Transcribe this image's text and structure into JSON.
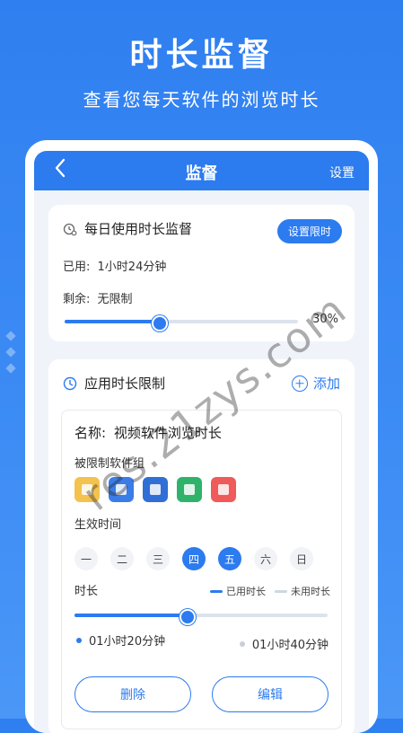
{
  "promo": {
    "title": "时长监督",
    "subtitle": "查看您每天软件的浏览时长"
  },
  "header": {
    "back_icon": "chevron-left-icon",
    "title": "监督",
    "action": "设置"
  },
  "daily": {
    "title": "每日使用时长监督",
    "set_limit": "设置限时",
    "used_label": "已用:",
    "used_value": "1小时24分钟",
    "remain_label": "剩余:",
    "remain_value": "无限制",
    "percent_text": "30%",
    "progress": 0.4
  },
  "limits": {
    "title": "应用时长限制",
    "add": "添加",
    "rule": {
      "name_label": "名称:",
      "name_value": "视频软件浏览时长",
      "group_label": "被限制软件组",
      "apps": [
        {
          "icon": "app-kids-icon",
          "color": "#f3c24f"
        },
        {
          "icon": "app-video-icon",
          "color": "#3a7de8"
        },
        {
          "icon": "app-pdf-icon",
          "color": "#2f6fd6"
        },
        {
          "icon": "app-lock-icon",
          "color": "#2fb36b"
        },
        {
          "icon": "app-share-icon",
          "color": "#ef5a5a"
        }
      ],
      "effective_label": "生效时间",
      "days": [
        {
          "label": "一",
          "on": false
        },
        {
          "label": "二",
          "on": false
        },
        {
          "label": "三",
          "on": false
        },
        {
          "label": "四",
          "on": true
        },
        {
          "label": "五",
          "on": true
        },
        {
          "label": "六",
          "on": false
        },
        {
          "label": "日",
          "on": false
        }
      ],
      "duration_label": "时长",
      "legend_used": "已用时长",
      "legend_unused": "未用时长",
      "used_time": "01小时20分钟",
      "unused_time": "01小时40分钟",
      "used_fraction": 0.44,
      "delete": "删除",
      "edit": "编辑"
    }
  },
  "watermark": "res.21zys.com",
  "colors": {
    "accent": "#2c7bef",
    "background": "#3d8cf5"
  }
}
